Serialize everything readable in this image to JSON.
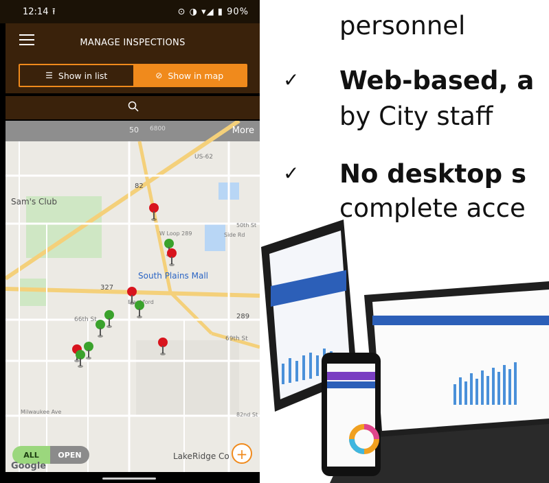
{
  "status_bar": {
    "time": "12:14",
    "upload": "⭱",
    "indicators": "⊙ ◑ ▾◢ ▮ 90%"
  },
  "header": {
    "title": "MANAGE INSPECTIONS"
  },
  "view_toggle": {
    "list_label": "Show in list",
    "list_icon": "☰",
    "map_label": "Show in map",
    "map_icon": "⊘",
    "selected": "map"
  },
  "map": {
    "more": "More",
    "labels": {
      "sams_club": "Sam's Club",
      "south_plains_mall": "South Plains Mall",
      "lakeridge": "LakeRidge Co",
      "st66": "66th St",
      "st69": "69th St",
      "st50": "50th St",
      "st82": "82nd St",
      "side_rd": "Side Rd",
      "w_loop": "W Loop 289",
      "frankford": "Frankford",
      "milwaukee": "Milwaukee Ave",
      "us62": "US-62",
      "n50": "50",
      "n6800": "6800",
      "hw82": "82",
      "hw327": "327",
      "hw289": "289"
    },
    "filter": {
      "all": "ALL",
      "open": "OPEN",
      "selected": "all"
    },
    "attribution": "Google",
    "add_label": "+"
  },
  "slide": {
    "line1": "personnel",
    "bullet2_bold": "Web-based, a",
    "line2b": "by City staff",
    "bullet3_bold": "No desktop s",
    "line3b": "complete acce",
    "check": "✓"
  },
  "colors": {
    "header_brown": "#3a220b",
    "accent_orange": "#f08a1c",
    "pin_red": "#d8141d",
    "pin_green": "#3aa22c"
  }
}
